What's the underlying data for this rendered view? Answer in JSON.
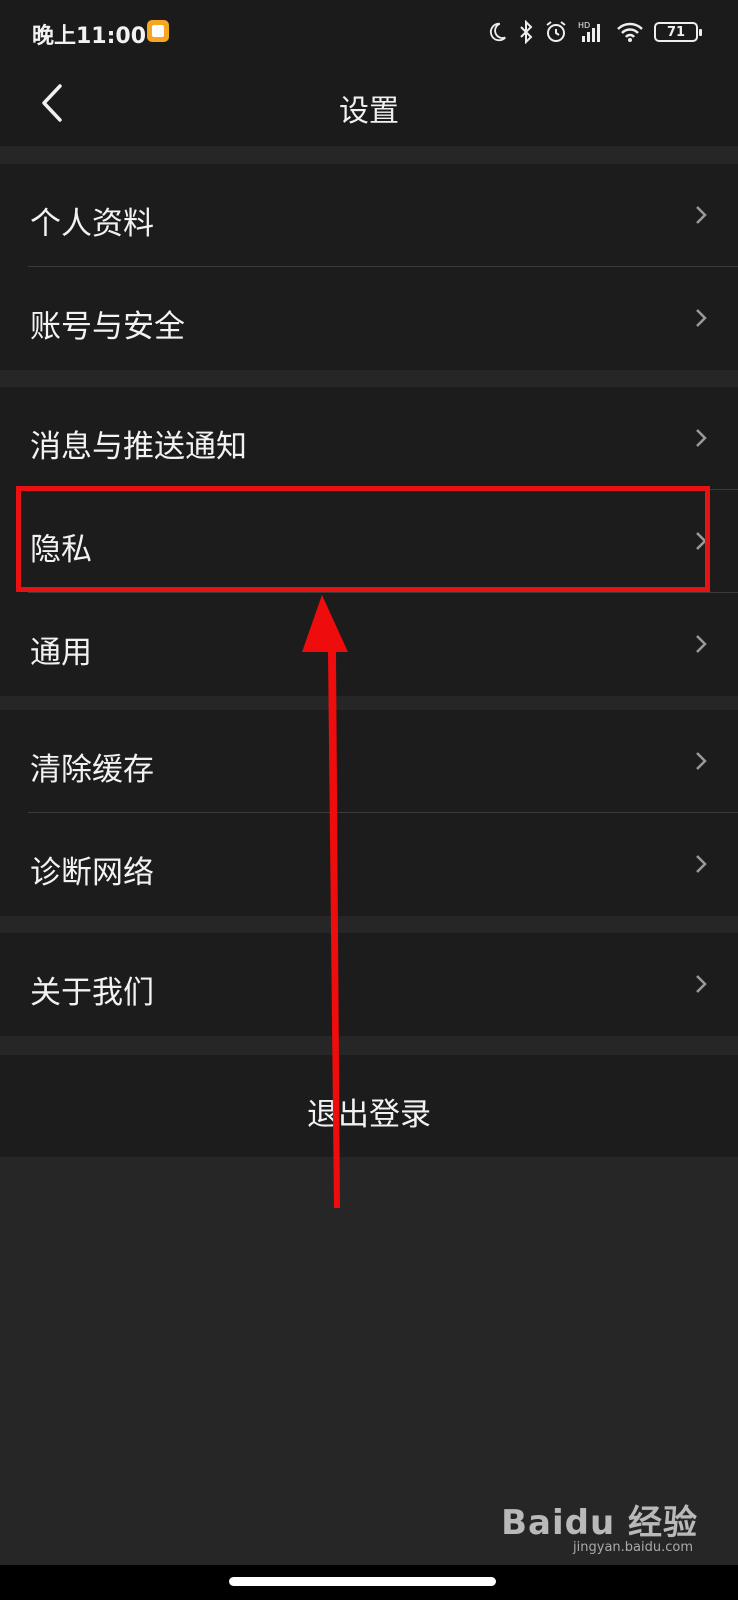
{
  "status": {
    "time": "晚上11:00",
    "battery": "71"
  },
  "nav": {
    "title": "设置"
  },
  "groups": [
    {
      "items": [
        {
          "label": "个人资料"
        },
        {
          "label": "账号与安全"
        }
      ]
    },
    {
      "items": [
        {
          "label": "消息与推送通知"
        },
        {
          "label": "隐私"
        },
        {
          "label": "通用"
        }
      ]
    },
    {
      "items": [
        {
          "label": "清除缓存"
        },
        {
          "label": "诊断网络"
        }
      ]
    },
    {
      "items": [
        {
          "label": "关于我们"
        }
      ]
    }
  ],
  "logout": {
    "label": "退出登录"
  },
  "watermark": {
    "brand": "Baidu 经验",
    "url": "jingyan.baidu.com"
  },
  "colors": {
    "highlight": "#e81212",
    "background": "#262626",
    "row_bg": "#1c1c1c"
  }
}
